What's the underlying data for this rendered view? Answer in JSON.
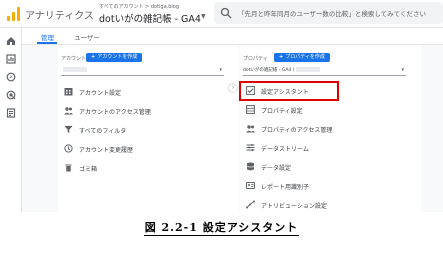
{
  "app": {
    "title": "アナリティクス",
    "breadcrumb": "すべてのアカウント > dotiga.blog",
    "property_name": "dotいがの雑記帳 - GA4",
    "brand_color": "#f9ab00"
  },
  "search": {
    "placeholder": "「先月と昨年同月のユーザー数の比較」と検索してみてください"
  },
  "tabs": [
    {
      "label": "管理",
      "active": true
    },
    {
      "label": "ユーザー",
      "active": false
    }
  ],
  "account": {
    "header_label": "アカウント",
    "add_button": "アカウントを作成",
    "selected": "",
    "items": [
      {
        "label": "アカウント設定",
        "icon": "building-icon"
      },
      {
        "label": "アカウントのアクセス管理",
        "icon": "people-icon"
      },
      {
        "label": "すべてのフィルタ",
        "icon": "filter-icon"
      },
      {
        "label": "アカウント変更履歴",
        "icon": "history-icon"
      },
      {
        "label": "ゴミ箱",
        "icon": "trash-icon"
      }
    ]
  },
  "property": {
    "header_label": "プロパティ",
    "add_button": "プロパティを作成",
    "selected": "dotいがの雑記帳 - GA4 (",
    "items": [
      {
        "label": "設定アシスタント",
        "icon": "check-box-icon"
      },
      {
        "label": "プロパティ設定",
        "icon": "settings-grid-icon"
      },
      {
        "label": "プロパティのアクセス管理",
        "icon": "people-icon"
      },
      {
        "label": "データストリーム",
        "icon": "streams-icon"
      },
      {
        "label": "データ設定",
        "icon": "database-icon"
      },
      {
        "label": "レポート用識別子",
        "icon": "id-icon"
      },
      {
        "label": "アトリビューション設定",
        "icon": "attribution-icon"
      }
    ]
  },
  "caption": "図 2.2-1  設定アシスタント",
  "colors": {
    "accent": "#1a73e8",
    "highlight": "#e00000"
  }
}
